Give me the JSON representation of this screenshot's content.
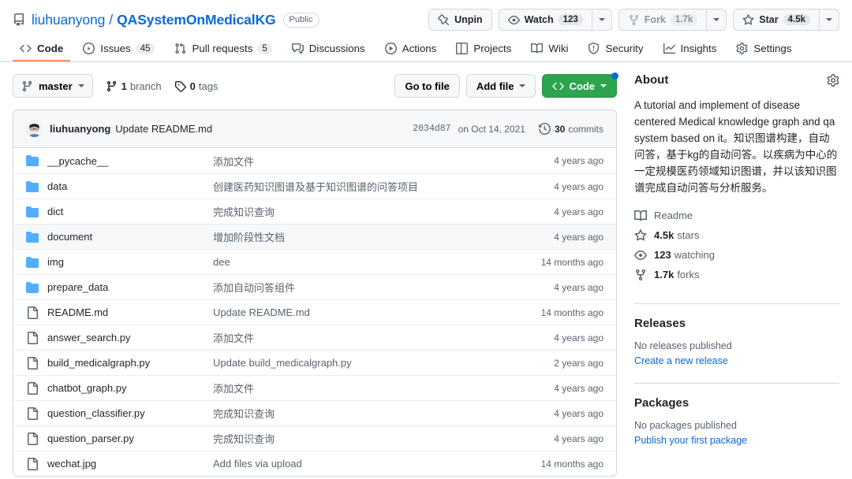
{
  "header": {
    "repo_icon": "repo-icon",
    "owner": "liuhuanyong",
    "separator": "/",
    "name": "QASystemOnMedicalKG",
    "visibility": "Public",
    "actions": {
      "unpin_label": "Unpin",
      "watch_label": "Watch",
      "watch_count": "123",
      "fork_label": "Fork",
      "fork_count": "1.7k",
      "star_label": "Star",
      "star_count": "4.5k"
    }
  },
  "nav": {
    "tabs": [
      {
        "label": "Code",
        "icon": "code-icon",
        "count": null,
        "selected": true
      },
      {
        "label": "Issues",
        "icon": "issue-opened-icon",
        "count": "45",
        "selected": false
      },
      {
        "label": "Pull requests",
        "icon": "git-pull-request-icon",
        "count": "5",
        "selected": false
      },
      {
        "label": "Discussions",
        "icon": "comment-discussion-icon",
        "count": null,
        "selected": false
      },
      {
        "label": "Actions",
        "icon": "play-icon",
        "count": null,
        "selected": false
      },
      {
        "label": "Projects",
        "icon": "table-icon",
        "count": null,
        "selected": false
      },
      {
        "label": "Wiki",
        "icon": "book-icon",
        "count": null,
        "selected": false
      },
      {
        "label": "Security",
        "icon": "shield-icon",
        "count": null,
        "selected": false
      },
      {
        "label": "Insights",
        "icon": "graph-icon",
        "count": null,
        "selected": false
      },
      {
        "label": "Settings",
        "icon": "gear-icon",
        "count": null,
        "selected": false
      }
    ]
  },
  "toolbar": {
    "branch": "master",
    "branch_count": "1",
    "branch_word": "branch",
    "tag_count": "0",
    "tag_word": "tags",
    "go_to_file": "Go to file",
    "add_file": "Add file",
    "code": "Code"
  },
  "commit": {
    "author": "liuhuanyong",
    "message": "Update README.md",
    "sha": "2034d87",
    "date": "on Oct 14, 2021",
    "commits_count": "30",
    "commits_word": "commits"
  },
  "files": [
    {
      "name": "__pycache__",
      "type": "folder",
      "message": "添加文件",
      "age": "4 years ago",
      "hovered": false
    },
    {
      "name": "data",
      "type": "folder",
      "message": "创建医药知识图谱及基于知识图谱的问答项目",
      "age": "4 years ago",
      "hovered": false
    },
    {
      "name": "dict",
      "type": "folder",
      "message": "完成知识查询",
      "age": "4 years ago",
      "hovered": false
    },
    {
      "name": "document",
      "type": "folder",
      "message": "增加阶段性文档",
      "age": "4 years ago",
      "hovered": true
    },
    {
      "name": "img",
      "type": "folder",
      "message": "dee",
      "age": "14 months ago",
      "hovered": false
    },
    {
      "name": "prepare_data",
      "type": "folder",
      "message": "添加自动问答组件",
      "age": "4 years ago",
      "hovered": false
    },
    {
      "name": "README.md",
      "type": "file",
      "message": "Update README.md",
      "age": "14 months ago",
      "hovered": false
    },
    {
      "name": "answer_search.py",
      "type": "file",
      "message": "添加文件",
      "age": "4 years ago",
      "hovered": false
    },
    {
      "name": "build_medicalgraph.py",
      "type": "file",
      "message": "Update build_medicalgraph.py",
      "age": "2 years ago",
      "hovered": false
    },
    {
      "name": "chatbot_graph.py",
      "type": "file",
      "message": "添加文件",
      "age": "4 years ago",
      "hovered": false
    },
    {
      "name": "question_classifier.py",
      "type": "file",
      "message": "完成知识查询",
      "age": "4 years ago",
      "hovered": false
    },
    {
      "name": "question_parser.py",
      "type": "file",
      "message": "完成知识查询",
      "age": "4 years ago",
      "hovered": false
    },
    {
      "name": "wechat.jpg",
      "type": "file",
      "message": "Add files via upload",
      "age": "14 months ago",
      "hovered": false
    }
  ],
  "about": {
    "title": "About",
    "settings_icon": "gear-icon",
    "description": "A tutorial and implement of disease centered Medical knowledge graph and qa system based on it。知识图谱构建，自动问答，基于kg的自动问答。以疾病为中心的一定规模医药领域知识图谱，并以该知识图谱完成自动问答与分析服务。",
    "readme_label": "Readme",
    "stars_count": "4.5k",
    "stars_label": "stars",
    "watching_count": "123",
    "watching_label": "watching",
    "forks_count": "1.7k",
    "forks_label": "forks"
  },
  "releases": {
    "title": "Releases",
    "empty": "No releases published",
    "link": "Create a new release"
  },
  "packages": {
    "title": "Packages",
    "empty": "No packages published",
    "link": "Publish your first package"
  },
  "colors": {
    "accent_blue": "#0969da",
    "green": "#2da44e",
    "active_tab_underline": "#fd8c73",
    "folder_blue": "#54aeff",
    "muted_text": "#59636e",
    "border": "#d1d9e0"
  }
}
